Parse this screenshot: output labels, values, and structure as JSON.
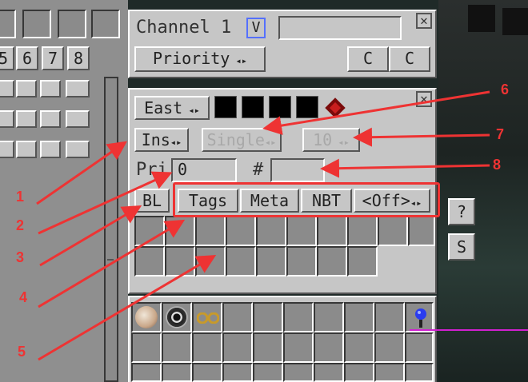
{
  "top_numbers": [
    "5",
    "6",
    "7",
    "8"
  ],
  "channel": {
    "title": "Channel 1",
    "v_label": "V",
    "priority_label": "Priority",
    "c1": "C",
    "c2": "C"
  },
  "side": {
    "direction": "East",
    "ins": "Ins",
    "mode": "Single",
    "stack": "10",
    "pri_label": "Pri",
    "pri_value": "0",
    "hash_label": "#",
    "bl": "BL",
    "tags": "Tags",
    "meta": "Meta",
    "nbt": "NBT",
    "off": "<Off>"
  },
  "right_buttons": {
    "help": "?",
    "s": "S"
  },
  "callouts": [
    "1",
    "2",
    "3",
    "4",
    "5",
    "6",
    "7",
    "8"
  ],
  "colors": {
    "callout": "#e33333",
    "accent_magenta": "#d020d0"
  }
}
